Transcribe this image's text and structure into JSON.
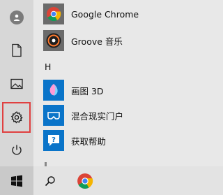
{
  "rail": {
    "items": [
      {
        "name": "user-avatar",
        "icon": "person-icon"
      },
      {
        "name": "documents",
        "icon": "document-icon"
      },
      {
        "name": "pictures",
        "icon": "pictures-icon"
      },
      {
        "name": "settings",
        "icon": "gear-icon",
        "highlighted": true
      },
      {
        "name": "power",
        "icon": "power-icon"
      }
    ]
  },
  "apps": [
    {
      "label": "Google Chrome",
      "icon": "chrome-icon",
      "tile_color": "#6b6b6b"
    },
    {
      "label": "Groove 音乐",
      "icon": "groove-music-icon",
      "tile_color": "#6b6b6b"
    }
  ],
  "section_h": {
    "letter": "H",
    "apps": [
      {
        "label": "画图 3D",
        "icon": "paint-3d-icon",
        "tile_color": "#0a74c9"
      },
      {
        "label": "混合现实门户",
        "icon": "mixed-reality-icon",
        "tile_color": "#0a74c9"
      },
      {
        "label": "获取帮助",
        "icon": "get-help-icon",
        "tile_color": "#0a74c9"
      }
    ]
  },
  "taskbar": {
    "items": [
      "windows-logo-icon",
      "search-icon",
      "chrome-icon"
    ]
  },
  "colors": {
    "highlight_border": "#e04040",
    "accent_blue": "#0a74c9"
  }
}
